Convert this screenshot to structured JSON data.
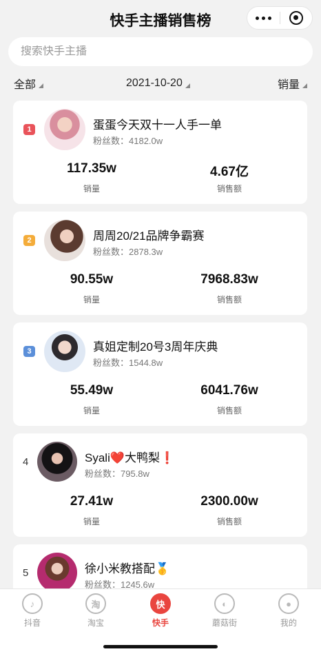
{
  "header": {
    "title": "快手主播销售榜"
  },
  "search": {
    "placeholder": "搜索快手主播"
  },
  "filters": {
    "all": "全部",
    "date": "2021-10-20",
    "sort": "销量"
  },
  "ranking": [
    {
      "rank": "1",
      "name": "蛋蛋今天双十一人手一单",
      "fans": "粉丝数：4182.0w",
      "sales": "117.35w",
      "sales_label": "销量",
      "revenue": "4.67亿",
      "revenue_label": "销售额",
      "badge_color": "#e9535a"
    },
    {
      "rank": "2",
      "name": "周周20/21品牌争霸赛",
      "fans": "粉丝数：2878.3w",
      "sales": "90.55w",
      "sales_label": "销量",
      "revenue": "7968.83w",
      "revenue_label": "销售额",
      "badge_color": "#f4ac3a"
    },
    {
      "rank": "3",
      "name": "真姐定制20号3周年庆典",
      "fans": "粉丝数：1544.8w",
      "sales": "55.49w",
      "sales_label": "销量",
      "revenue": "6041.76w",
      "revenue_label": "销售额",
      "badge_color": "#5b8fd9"
    },
    {
      "rank": "4",
      "name": "Syali❤️大鸭梨❗",
      "fans": "粉丝数：795.8w",
      "sales": "27.41w",
      "sales_label": "销量",
      "revenue": "2300.00w",
      "revenue_label": "销售额"
    },
    {
      "rank": "5",
      "name": "徐小米教搭配🥇",
      "fans": "粉丝数：1245.6w"
    }
  ],
  "tabs": [
    {
      "label": "抖音",
      "icon": "douyin-icon",
      "glyph": "♪"
    },
    {
      "label": "淘宝",
      "icon": "taobao-icon",
      "glyph": "淘"
    },
    {
      "label": "快手",
      "icon": "kuaishou-icon",
      "glyph": "快",
      "active": true
    },
    {
      "label": "蘑菇街",
      "icon": "mogujie-icon",
      "glyph": "◐"
    },
    {
      "label": "我的",
      "icon": "profile-icon",
      "glyph": "●"
    }
  ],
  "colors": {
    "accent": "#e9453f",
    "background": "#f2f2f2"
  }
}
